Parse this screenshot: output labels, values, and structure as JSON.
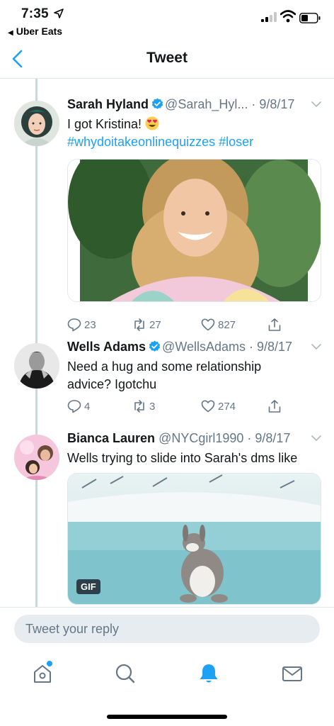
{
  "status_bar": {
    "time": "7:35",
    "back_app": "Uber Eats"
  },
  "nav": {
    "title": "Tweet"
  },
  "tweets": [
    {
      "name": "Sarah Hyland",
      "verified": true,
      "handle": "@Sarah_Hyl...",
      "date": "· 9/8/17",
      "text": "I got Kristina!",
      "emoji": "heart-eyes",
      "hashtags": "#whydoitakeonlinequizzes #loser",
      "media": "photo",
      "replies": "23",
      "retweets": "27",
      "likes": "827"
    },
    {
      "name": "Wells Adams",
      "verified": true,
      "handle": "@WellsAdams",
      "date": "· 9/8/17",
      "text_line1": "Need a hug and some relationship",
      "text_line2": "advice? Igotchu",
      "replies": "4",
      "retweets": "3",
      "likes": "274"
    },
    {
      "name": "Bianca Lauren",
      "verified": false,
      "handle": "@NYCgirl1990",
      "date": "· 9/8/17",
      "text": "Wells trying to slide into Sarah's dms like",
      "media": "gif",
      "gif_badge": "GIF"
    }
  ],
  "reply": {
    "placeholder": "Tweet your reply"
  },
  "tabs": [
    "home-icon",
    "search-icon",
    "notifications-icon",
    "messages-icon"
  ],
  "colors": {
    "accent": "#1da1f2",
    "muted": "#657786",
    "text": "#14171a",
    "heart_eyes": "#ffcc4d"
  }
}
